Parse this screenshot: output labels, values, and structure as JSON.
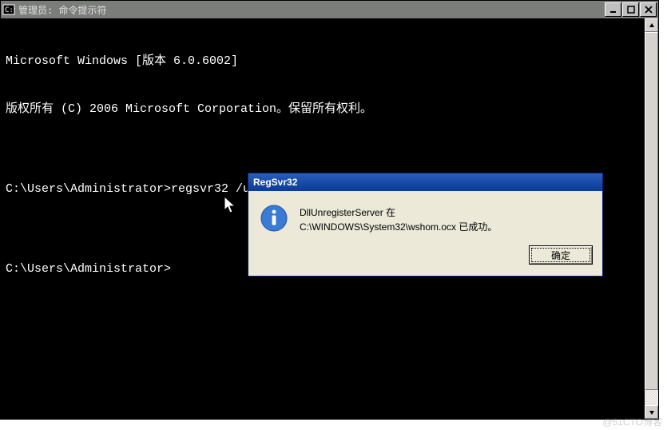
{
  "main_window": {
    "title": "管理员: 命令提示符",
    "controls": {
      "minimize": "minimize",
      "maximize": "maximize",
      "close": "close"
    }
  },
  "terminal": {
    "lines": [
      "Microsoft Windows [版本 6.0.6002]",
      "版权所有 (C) 2006 Microsoft Corporation。保留所有权利。",
      "",
      "C:\\Users\\Administrator>regsvr32 /u C:\\WINDOWS\\System32\\wshom.ocx",
      "",
      "C:\\Users\\Administrator>"
    ]
  },
  "dialog": {
    "title": "RegSvr32",
    "message_line1": "DllUnregisterServer 在",
    "message_line2": "C:\\WINDOWS\\System32\\wshom.ocx 已成功。",
    "ok_label": "确定"
  },
  "watermark": "@51CTO博客"
}
